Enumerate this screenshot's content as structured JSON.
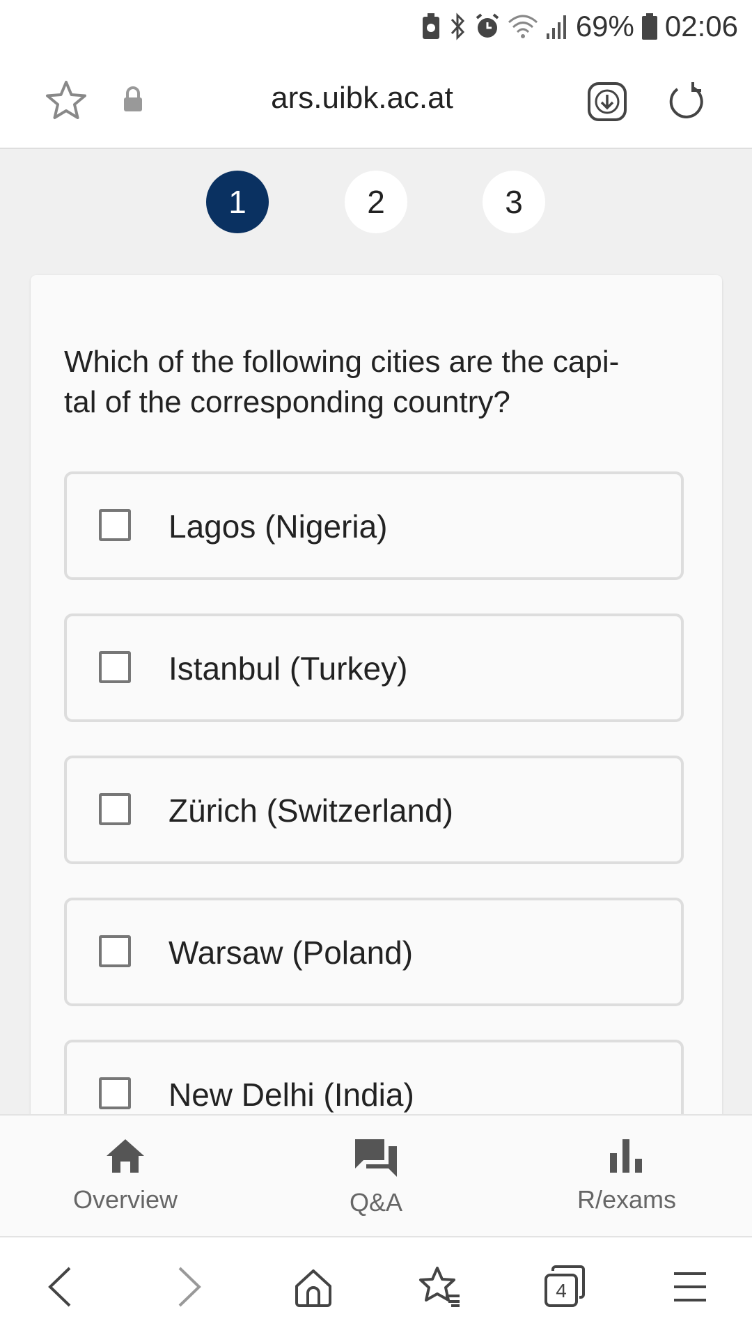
{
  "status_bar": {
    "battery_percent": "69%",
    "time": "02:06",
    "icons": [
      "battery-saver-icon",
      "bluetooth-icon",
      "alarm-icon",
      "wifi-icon",
      "signal-icon",
      "battery-icon"
    ]
  },
  "url_bar": {
    "url": "ars.uibk.ac.at",
    "icons": [
      "star-icon",
      "lock-icon",
      "download-icon",
      "reload-icon"
    ]
  },
  "steps": [
    {
      "label": "1",
      "active": true
    },
    {
      "label": "2",
      "active": false
    },
    {
      "label": "3",
      "active": false
    }
  ],
  "question": {
    "line1": "Which of the following cities are the capi-",
    "line2": "tal of the corresponding country?"
  },
  "options": [
    {
      "label": "Lagos (Nigeria)",
      "checked": false
    },
    {
      "label": "Istanbul (Turkey)",
      "checked": false
    },
    {
      "label": "Zürich (Switzerland)",
      "checked": false
    },
    {
      "label": "Warsaw (Poland)",
      "checked": false
    },
    {
      "label": "New Delhi (India)",
      "checked": false
    }
  ],
  "app_nav": [
    {
      "label": "Overview",
      "icon": "home-icon"
    },
    {
      "label": "Q&A",
      "icon": "chat-icon"
    },
    {
      "label": "R/exams",
      "icon": "bar-chart-icon"
    }
  ],
  "browser_toolbar": {
    "tab_count": "4",
    "icons": [
      "back-icon",
      "forward-icon",
      "home-icon",
      "bookmarks-icon",
      "tabs-icon",
      "menu-icon"
    ]
  },
  "colors": {
    "step_active": "#0a3161",
    "background": "#f0f0f0",
    "card": "#fafafa"
  }
}
